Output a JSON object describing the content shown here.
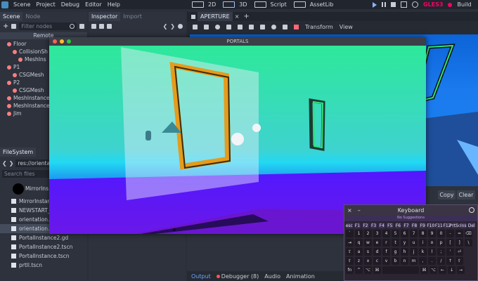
{
  "menu": {
    "items": [
      "Scene",
      "Project",
      "Debug",
      "Editor",
      "Help"
    ],
    "workspaces": [
      "2D",
      "3D",
      "Script",
      "AssetLib"
    ],
    "renderer": "GLES3",
    "build": "Build"
  },
  "scene_dock": {
    "tabs": [
      "Scene",
      "Node"
    ],
    "filter_placeholder": "Filter nodes",
    "remote_label": "Remote",
    "nodes": [
      {
        "label": "Floor",
        "color": "#fc7f7f",
        "indent": 10
      },
      {
        "label": "CollisionSh",
        "color": "#fc7f7f",
        "indent": 18
      },
      {
        "label": "MeshIns",
        "color": "#fc7f7f",
        "indent": 26
      },
      {
        "label": "P1",
        "color": "#fc7f7f",
        "indent": 10
      },
      {
        "label": "CSGMesh",
        "color": "#fc7f7f",
        "indent": 18
      },
      {
        "label": "P2",
        "color": "#fc7f7f",
        "indent": 10
      },
      {
        "label": "CSGMesh",
        "color": "#fc7f7f",
        "indent": 18
      },
      {
        "label": "MeshInstance",
        "color": "#fc7f7f",
        "indent": 10
      },
      {
        "label": "MeshInstance",
        "color": "#fc7f7f",
        "indent": 10
      },
      {
        "label": "Jim",
        "color": "#fc7f7f",
        "indent": 10
      }
    ]
  },
  "inspector_dock": {
    "tabs": [
      "Inspector",
      "Import"
    ]
  },
  "filesystem": {
    "title": "FileSystem",
    "path": "res://orientat",
    "search_placeholder": "Search files",
    "thumb_label": "MirrorIns",
    "files": [
      "MirrorInstan",
      "NEWSTART_",
      "orientation.p",
      "orientation.tscn",
      "PortalInstance2.gd",
      "PortalInstance2.tscn",
      "PortalInstance.tscn",
      "prtll.tscn"
    ],
    "selected_index": 3
  },
  "viewport": {
    "tab": "APERTURE",
    "tools": [
      "Transform",
      "View"
    ]
  },
  "game_window": {
    "title": "PORTALS"
  },
  "output": {
    "copy": "Copy",
    "clear": "Clear",
    "tabs": [
      "Output",
      "Debugger (8)",
      "Audio",
      "Animation"
    ]
  },
  "keyboard": {
    "title": "Keyboard",
    "suggestions": "No Suggestions",
    "row1": [
      "esc",
      "F1",
      "F2",
      "F3",
      "F4",
      "F5",
      "F6",
      "F7",
      "F8",
      "F9",
      "F10",
      "F11",
      "F12",
      "PrtSc",
      "Ins",
      "Del"
    ],
    "row2": [
      "`",
      "1",
      "2",
      "3",
      "4",
      "5",
      "6",
      "7",
      "8",
      "9",
      "0",
      "-",
      "=",
      "⌫"
    ],
    "row3": [
      "⇥",
      "q",
      "w",
      "e",
      "r",
      "t",
      "y",
      "u",
      "i",
      "o",
      "p",
      "[",
      "]",
      "\\"
    ],
    "row4": [
      "⇪",
      "a",
      "s",
      "d",
      "f",
      "g",
      "h",
      "j",
      "k",
      "l",
      ";",
      "'",
      "⏎"
    ],
    "row5": [
      "⇧",
      "z",
      "x",
      "c",
      "v",
      "b",
      "n",
      "m",
      ",",
      ".",
      "/",
      "↑",
      "⇧"
    ],
    "row6": [
      "fn",
      "^",
      "⌥",
      "⌘",
      "",
      "⌘",
      "⌥",
      "←",
      "↓",
      "→"
    ]
  }
}
